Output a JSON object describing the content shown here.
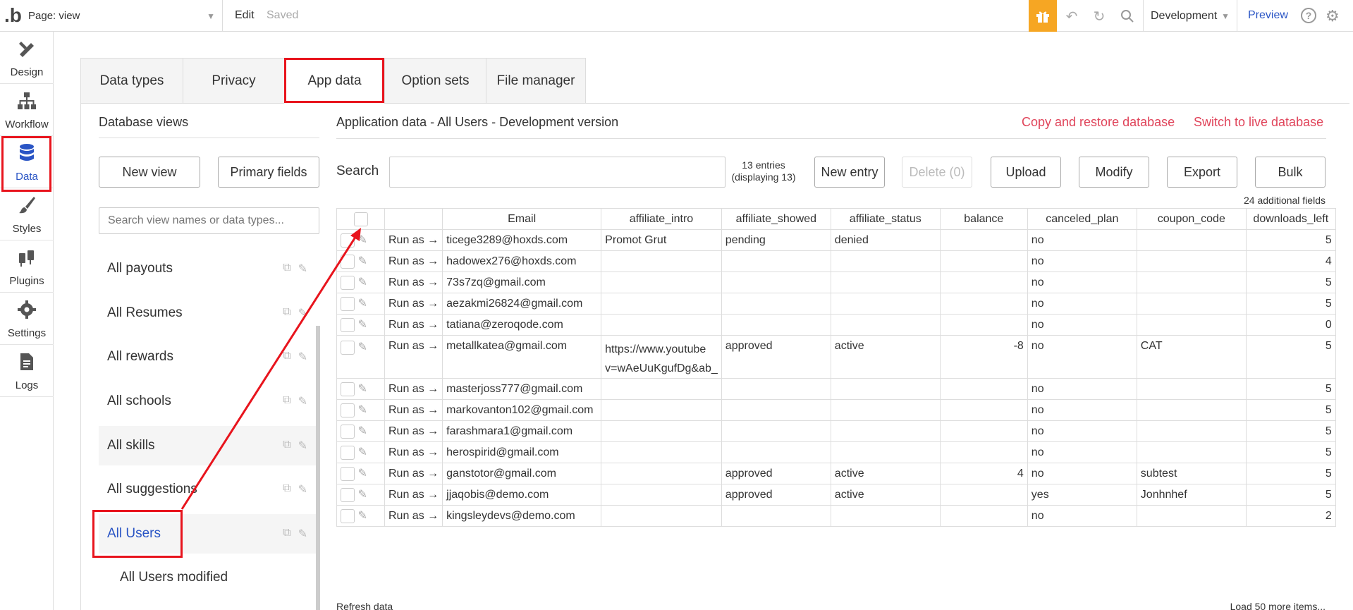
{
  "topbar": {
    "logo": ".b",
    "page_label": "Page: view",
    "edit_label": "Edit",
    "saved_label": "Saved",
    "environment": "Development",
    "preview_label": "Preview",
    "help_label": "?"
  },
  "sidebar": {
    "items": [
      {
        "label": "Design",
        "icon": "design-icon"
      },
      {
        "label": "Workflow",
        "icon": "workflow-icon"
      },
      {
        "label": "Data",
        "icon": "database-icon"
      },
      {
        "label": "Styles",
        "icon": "brush-icon"
      },
      {
        "label": "Plugins",
        "icon": "plug-icon"
      },
      {
        "label": "Settings",
        "icon": "gear-icon"
      },
      {
        "label": "Logs",
        "icon": "document-icon"
      }
    ]
  },
  "tabs": [
    "Data types",
    "Privacy",
    "App data",
    "Option sets",
    "File manager"
  ],
  "database_views": {
    "title": "Database views",
    "new_view_label": "New view",
    "primary_fields_label": "Primary fields",
    "search_placeholder": "Search view names or data types...",
    "views": [
      "All payouts",
      "All Resumes",
      "All rewards",
      "All schools",
      "All skills",
      "All suggestions",
      "All Users",
      "All Users modified"
    ]
  },
  "app_data": {
    "title": "Application data - All Users - Development version",
    "copy_restore_label": "Copy and restore database",
    "switch_live_label": "Switch to live database",
    "search_label": "Search",
    "entries_line1": "13 entries",
    "entries_line2": "(displaying 13)",
    "new_entry_label": "New entry",
    "delete_label": "Delete (0)",
    "upload_label": "Upload",
    "modify_label": "Modify",
    "export_label": "Export",
    "bulk_label": "Bulk",
    "additional_fields": "24 additional fields",
    "refresh_label": "Refresh data",
    "load_more_label": "Load 50 more items...",
    "run_as_label": "Run as →",
    "columns": [
      "Email",
      "affiliate_intro",
      "affiliate_showed",
      "affiliate_status",
      "balance",
      "canceled_plan",
      "coupon_code",
      "downloads_left"
    ],
    "rows": [
      {
        "email": "ticege3289@hoxds.com",
        "intro": "Promot Grut",
        "showed": "pending",
        "status": "denied",
        "balance": "",
        "canceled": "no",
        "coupon": "",
        "downloads": "5"
      },
      {
        "email": "hadowex276@hoxds.com",
        "intro": "",
        "showed": "",
        "status": "",
        "balance": "",
        "canceled": "no",
        "coupon": "",
        "downloads": "4"
      },
      {
        "email": "73s7zq@gmail.com",
        "intro": "",
        "showed": "",
        "status": "",
        "balance": "",
        "canceled": "no",
        "coupon": "",
        "downloads": "5"
      },
      {
        "email": "aezakmi26824@gmail.com",
        "intro": "",
        "showed": "",
        "status": "",
        "balance": "",
        "canceled": "no",
        "coupon": "",
        "downloads": "5"
      },
      {
        "email": "tatiana@zeroqode.com",
        "intro": "",
        "showed": "",
        "status": "",
        "balance": "",
        "canceled": "no",
        "coupon": "",
        "downloads": "0"
      },
      {
        "email": "metallkatea@gmail.com",
        "intro": "https://www.youtube v=wAeUuKgufDg&ab_",
        "showed": "approved",
        "status": "active",
        "balance": "-8",
        "canceled": "no",
        "coupon": "CAT",
        "downloads": "5"
      },
      {
        "email": "masterjoss777@gmail.com",
        "intro": "",
        "showed": "",
        "status": "",
        "balance": "",
        "canceled": "no",
        "coupon": "",
        "downloads": "5"
      },
      {
        "email": "markovanton102@gmail.com",
        "intro": "",
        "showed": "",
        "status": "",
        "balance": "",
        "canceled": "no",
        "coupon": "",
        "downloads": "5"
      },
      {
        "email": "farashmara1@gmail.com",
        "intro": "",
        "showed": "",
        "status": "",
        "balance": "",
        "canceled": "no",
        "coupon": "",
        "downloads": "5"
      },
      {
        "email": "herospirid@gmail.com",
        "intro": "",
        "showed": "",
        "status": "",
        "balance": "",
        "canceled": "no",
        "coupon": "",
        "downloads": "5"
      },
      {
        "email": "ganstotor@gmail.com",
        "intro": "",
        "showed": "approved",
        "status": "active",
        "balance": "4",
        "canceled": "no",
        "coupon": "subtest",
        "downloads": "5"
      },
      {
        "email": "jjaqobis@demo.com",
        "intro": "",
        "showed": "approved",
        "status": "active",
        "balance": "",
        "canceled": "yes",
        "coupon": "Jonhnhef",
        "downloads": "5"
      },
      {
        "email": "kingsleydevs@demo.com",
        "intro": "",
        "showed": "",
        "status": "",
        "balance": "",
        "canceled": "no",
        "coupon": "",
        "downloads": "2"
      }
    ]
  },
  "colors": {
    "accent_blue": "#2a55c5",
    "highlight_red": "#e8141d",
    "link_red": "#e0445a",
    "gift_orange": "#f6a623"
  }
}
